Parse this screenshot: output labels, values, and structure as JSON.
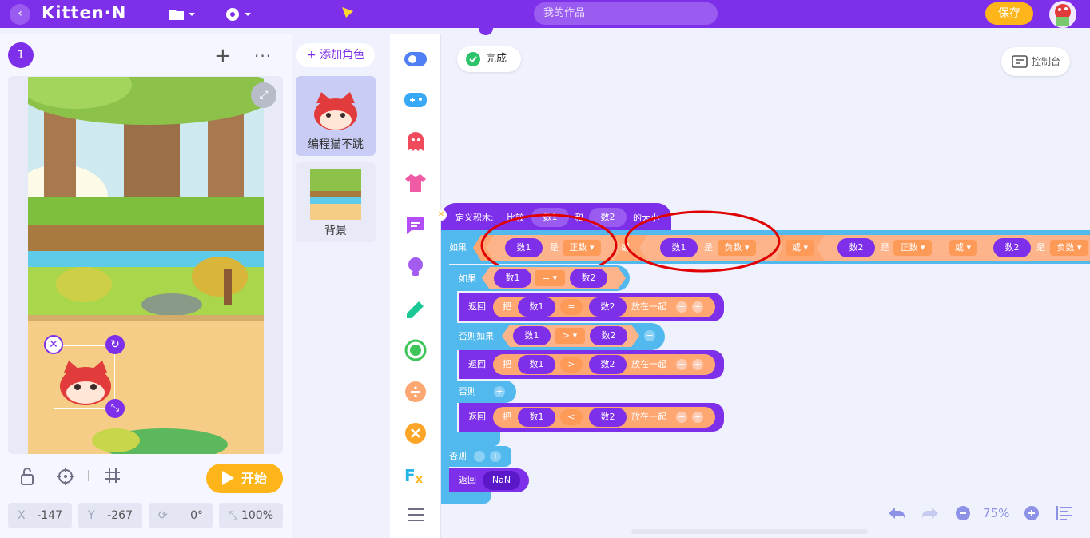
{
  "app": {
    "logo": "Kitten·N",
    "search_placeholder": "我的作品",
    "save_label": "保存"
  },
  "left": {
    "scene_number": "1",
    "start_label": "开始",
    "coords": [
      {
        "label": "X",
        "value": "-147"
      },
      {
        "label": "Y",
        "value": "-267"
      },
      {
        "label": "",
        "value": "0°"
      },
      {
        "label": "",
        "value": "100%"
      }
    ]
  },
  "sprites": {
    "add_label": "+ 添加角色",
    "items": [
      {
        "label": "编程猫不跳"
      },
      {
        "label": "背景"
      }
    ]
  },
  "workspace": {
    "done_label": "完成",
    "console_label": "控制台",
    "zoom": "75%",
    "define": {
      "prefix": "定义积木:",
      "compare": "比较",
      "param1": "数1",
      "and": "和",
      "param2": "数2",
      "suffix": "的大小"
    },
    "if_row": {
      "if": "如果",
      "a": "数1",
      "is": "是",
      "positive": "正数",
      "or": "或",
      "b": "数1",
      "negative": "负数",
      "or2": "或",
      "c": "数2",
      "positive2": "正数",
      "or3": "或",
      "d": "数2",
      "negative2": "负数"
    },
    "inner_if": {
      "label": "如果",
      "a": "数1",
      "op": "=",
      "b": "数2"
    },
    "return1": {
      "label": "返回",
      "join": "把",
      "a": "数1",
      "op": "=",
      "b": "数2",
      "together": "放在一起"
    },
    "elseif": {
      "label": "否则如果",
      "a": "数1",
      "op": ">",
      "b": "数2"
    },
    "return2": {
      "label": "返回",
      "join": "把",
      "a": "数1",
      "op": ">",
      "b": "数2",
      "together": "放在一起"
    },
    "else": {
      "label": "否则"
    },
    "return3": {
      "label": "返回",
      "join": "把",
      "a": "数1",
      "op": "<",
      "b": "数2",
      "together": "放在一起"
    },
    "outer_else": {
      "label": "否则"
    },
    "return4": {
      "label": "返回",
      "value": "NaN"
    }
  },
  "colors": {
    "brand": "#7e2fe9",
    "accent": "#fdb51a",
    "logic": "#52b9ee",
    "operator": "#fea772",
    "highlight": "#e00000"
  }
}
